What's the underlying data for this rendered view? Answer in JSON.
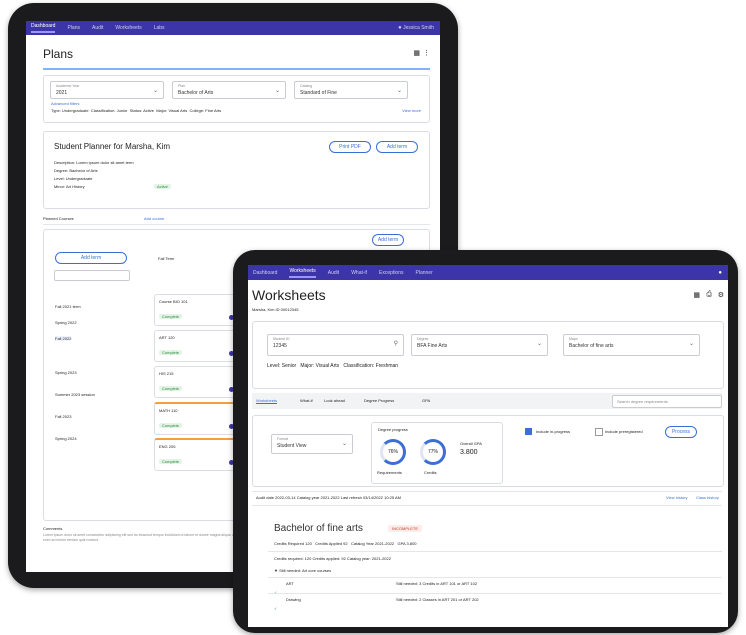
{
  "back": {
    "nav": [
      "Dashboard",
      "Plans",
      "Audit",
      "Worksheets",
      "Labs"
    ],
    "user": "Jessica Smith",
    "title": "Plans",
    "filters": [
      {
        "label": "Academic Year",
        "value": "2021"
      },
      {
        "label": "Plan",
        "value": "Bachelor of Arts"
      },
      {
        "label": "Catalog",
        "value": "Standard of Fine"
      }
    ],
    "filter_link": "Advanced filters",
    "meta_line": [
      "Type: Undergraduate",
      "Classification: Junior",
      "Status: Active",
      "Major: Visual Arts",
      "College: Fine Arts"
    ],
    "view_more": "View more",
    "card_title": "Student Planner for Marsha, Kim",
    "card_buttons": [
      "Print PDF",
      "Add term"
    ],
    "card_rows": [
      "Description: Lorem ipsum dolor sit amet term",
      "Degree: Bachelor of Arts",
      "Level: Undergraduate",
      "Minor: Art History"
    ],
    "card_status": "Active",
    "section_label": "Planned Courses",
    "section_link": "Add course",
    "side_button": "Add term",
    "side_items": [
      "Fall 2021 term",
      "Spring 2022",
      "Fall 2022",
      "Spring 2023",
      "Summer 2023 session",
      "Fall 2023",
      "Spring 2024"
    ],
    "term_cards": [
      "Fall Term",
      "Course BIO 101",
      "ART 120",
      "HIS 215",
      "MATH 110",
      "ENG 205"
    ],
    "term_tag": "Complete",
    "footer_title": "Comments",
    "footer_text": "Lorem ipsum dolor sit amet consectetur adipiscing elit sed do eiusmod tempor incididunt ut labore et dolore magna aliqua ut enim ad minim veniam quis nostrud"
  },
  "front": {
    "nav": [
      "Dashboard",
      "Worksheets",
      "Audit",
      "What-if",
      "Exceptions",
      "Planner"
    ],
    "title": "Worksheets",
    "subtitle": "Marsha, Kim  ID 00012345",
    "fields": [
      {
        "label": "Student ID",
        "value": "12345"
      },
      {
        "label": "Degree",
        "value": "BFA Fine Arts"
      },
      {
        "label": "Major",
        "value": "Bachelor of fine arts"
      }
    ],
    "info_line": [
      "Level: Senior",
      "Major: Visual Arts",
      "Classification: Freshman"
    ],
    "tabs": [
      "Worksheets",
      "What-if",
      "Look ahead",
      "Degree Progress",
      "GPA"
    ],
    "search_placeholder": "Search degree requirements",
    "format_field": {
      "label": "Format",
      "value": "Student View"
    },
    "progress_title": "Degree progress",
    "progress": [
      {
        "label": "Requirements",
        "value": "76%",
        "pct": 76
      },
      {
        "label": "Credits",
        "value": "77%",
        "pct": 77
      }
    ],
    "gpa": {
      "label": "Overall GPA",
      "value": "3.800"
    },
    "checkboxes": [
      "Include in-progress",
      "Include preregistered"
    ],
    "process_button": "Process",
    "audit_line": "Audit date 2022-03-14   Catalog year 2021-2022   Last refresh 03/14/2022 10:25 AM",
    "audit_links": [
      "View history",
      "Class history"
    ],
    "degree_title": "Bachelor of fine arts",
    "degree_status": "INCOMPLETE",
    "degree_meta": [
      "Credits Required 120",
      "Credits Applied 92",
      "Catalog Year 2021-2022",
      "GPA 3.800"
    ],
    "req_header": "Credits required: 120   Credits applied: 92   Catalog year: 2021-2022",
    "req_subheader": "Still needed: Art core courses",
    "req_rows": [
      {
        "code": "ART",
        "text": "Still needed: 3 Credits in ART 101 or ART 102"
      },
      {
        "code": "Drawing",
        "text": "Still needed: 2 Classes in ART 201 or ART 202"
      }
    ]
  }
}
